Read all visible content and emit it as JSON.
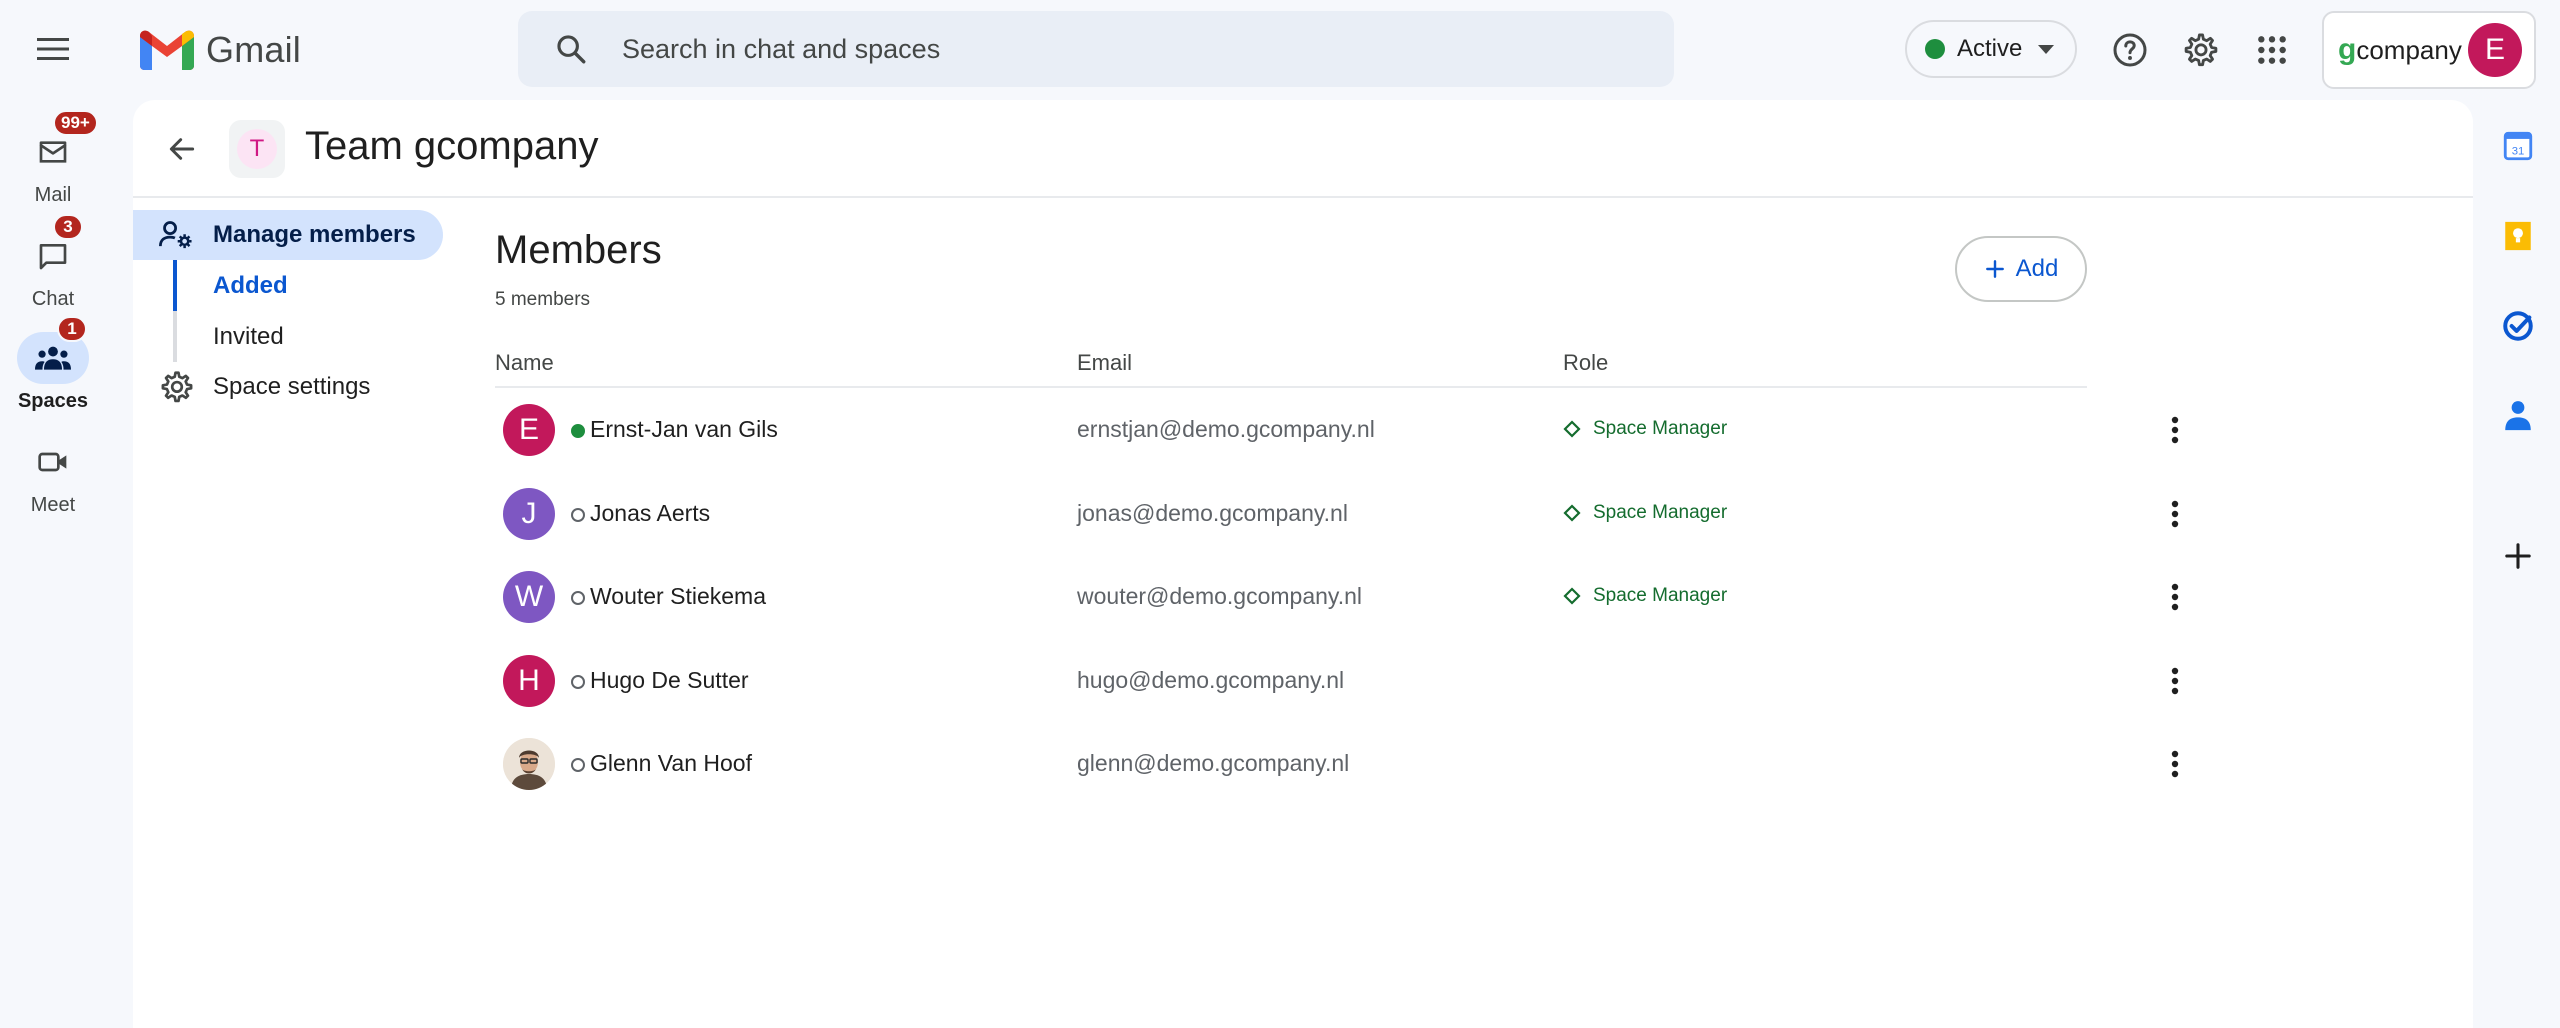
{
  "app": {
    "name": "Gmail"
  },
  "search": {
    "placeholder": "Search in chat and spaces"
  },
  "status": {
    "label": "Active",
    "color": "#1e8e3e"
  },
  "account": {
    "org_prefix": "g",
    "org_name": "company",
    "avatar_initial": "E"
  },
  "rail": {
    "items": [
      {
        "label": "Mail",
        "badge": "99+",
        "icon": "mail-icon"
      },
      {
        "label": "Chat",
        "badge": "3",
        "icon": "chat-icon"
      },
      {
        "label": "Spaces",
        "badge": "1",
        "icon": "spaces-icon"
      },
      {
        "label": "Meet",
        "badge": "",
        "icon": "video-icon"
      }
    ]
  },
  "space": {
    "title": "Team gcompany",
    "initial": "T"
  },
  "nav": {
    "manage": "Manage members",
    "added": "Added",
    "invited": "Invited",
    "settings": "Space settings"
  },
  "members": {
    "title": "Members",
    "count": "5 members",
    "add_label": "Add",
    "columns": {
      "name": "Name",
      "email": "Email",
      "role": "Role"
    },
    "rows": [
      {
        "initial": "E",
        "color": "#c2185b",
        "online": true,
        "name": "Ernst-Jan van Gils",
        "email": "ernstjan@demo.gcompany.nl",
        "role": "Space Manager"
      },
      {
        "initial": "J",
        "color": "#7e57c2",
        "online": false,
        "name": "Jonas Aerts",
        "email": "jonas@demo.gcompany.nl",
        "role": "Space Manager"
      },
      {
        "initial": "W",
        "color": "#7e57c2",
        "online": false,
        "name": "Wouter Stiekema",
        "email": "wouter@demo.gcompany.nl",
        "role": "Space Manager"
      },
      {
        "initial": "H",
        "color": "#c2185b",
        "online": false,
        "name": "Hugo De Sutter",
        "email": "hugo@demo.gcompany.nl",
        "role": ""
      },
      {
        "initial": "",
        "color": "#8d6e63",
        "online": false,
        "name": "Glenn Van Hoof",
        "email": "glenn@demo.gcompany.nl",
        "role": ""
      }
    ]
  },
  "side_panel": {
    "calendar_day": "31",
    "icons": [
      "calendar-icon",
      "keep-icon",
      "tasks-icon",
      "contacts-icon",
      "add-addon-icon"
    ]
  }
}
